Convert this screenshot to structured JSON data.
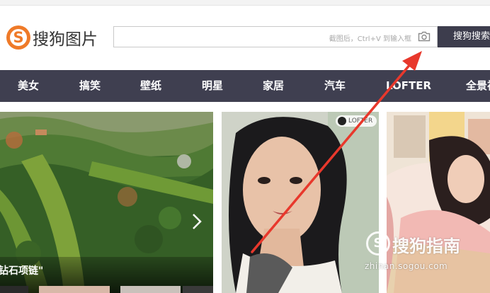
{
  "logo": {
    "mark": "S",
    "text": "搜狗图片"
  },
  "search": {
    "value": "",
    "hint": "截图后，Ctrl+V 到输入框",
    "button_label": "搜狗搜索"
  },
  "nav": {
    "items": [
      "美女",
      "搞笑",
      "壁纸",
      "明星",
      "家居",
      "汽车",
      "LOFTER",
      "全景视"
    ]
  },
  "cards": {
    "caption": "钻石项链\"",
    "badge": "LOFTER"
  },
  "watermark": {
    "title": "搜狗指南",
    "url": "zhinan.sogou.com"
  },
  "colors": {
    "nav_bg": "#3f3f50",
    "brand_orange": "#ef7a28",
    "arrow": "#e8382c"
  }
}
